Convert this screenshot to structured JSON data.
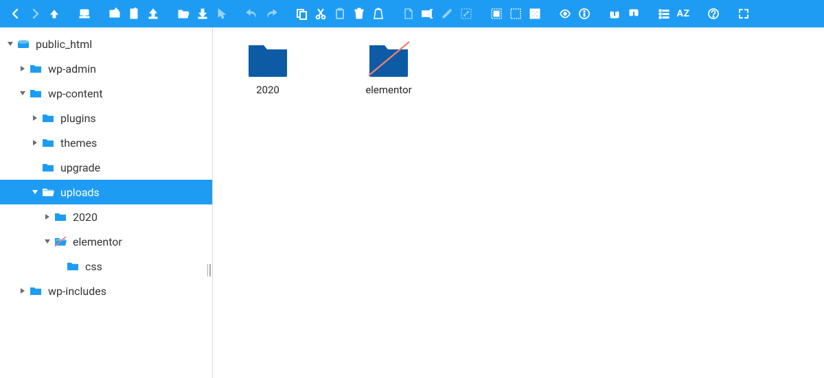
{
  "toolbar": {
    "sort_label": "AZ"
  },
  "tree": {
    "root": "public_html",
    "wp_admin": "wp-admin",
    "wp_content": "wp-content",
    "plugins": "plugins",
    "themes": "themes",
    "upgrade": "upgrade",
    "uploads": "uploads",
    "year2020": "2020",
    "elementor": "elementor",
    "css": "css",
    "wp_includes": "wp-includes"
  },
  "content": {
    "items": [
      {
        "label": "2020",
        "strike": false
      },
      {
        "label": "elementor",
        "strike": true
      }
    ]
  },
  "colors": {
    "accent": "#1e9cf3",
    "folder_blue": "#0d5ba5",
    "folder_light": "#1e9cf3",
    "tree_icon": "#1e9cf3"
  }
}
